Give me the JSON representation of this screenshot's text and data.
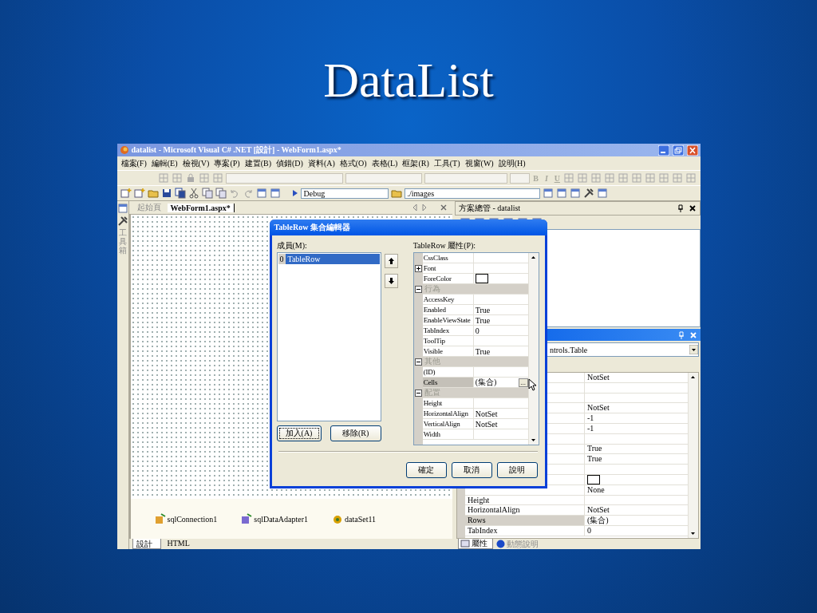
{
  "slide": {
    "title": "DataList"
  },
  "window": {
    "title": "datalist - Microsoft Visual C# .NET [設計] - WebForm1.aspx*"
  },
  "menu": [
    "檔案(F)",
    "編輯(E)",
    "檢視(V)",
    "專案(P)",
    "建置(B)",
    "偵錯(D)",
    "資料(A)",
    "格式(O)",
    "表格(L)",
    "框架(R)",
    "工具(T)",
    "視窗(W)",
    "說明(H)"
  ],
  "format_buttons": [
    {
      "label": "B",
      "disabled": true
    },
    {
      "label": "I",
      "disabled": true
    },
    {
      "label": "U",
      "disabled": true
    }
  ],
  "toolbar": {
    "configuration": "Debug",
    "path": "./images"
  },
  "side_strip": {
    "label": "工具箱"
  },
  "document_tabs": [
    {
      "label": "起始頁",
      "selected": false
    },
    {
      "label": "WebForm1.aspx*",
      "selected": true
    }
  ],
  "components": [
    "sqlConnection1",
    "sqlDataAdapter1",
    "dataSet11"
  ],
  "view_tabs": [
    {
      "label": "設計",
      "selected": true
    },
    {
      "label": "HTML",
      "selected": false
    }
  ],
  "solution_explorer": {
    "title": "方案總管 - datalist"
  },
  "properties": {
    "object": "ntrols.Table",
    "rows": [
      {
        "value": "NotSet",
        "kind": "text",
        "selected": false
      },
      {
        "kind": "blank",
        "selected": false
      },
      {
        "kind": "blank",
        "selected": false
      },
      {
        "value": "NotSet",
        "kind": "text",
        "selected": false
      },
      {
        "value": "-1",
        "kind": "text",
        "selected": false
      },
      {
        "value": "-1",
        "kind": "text",
        "selected": false
      },
      {
        "kind": "blank",
        "selected": false
      },
      {
        "value": "True",
        "kind": "text",
        "selected": false
      },
      {
        "value": "True",
        "kind": "text",
        "selected": false
      },
      {
        "kind": "blank",
        "selected": false
      },
      {
        "kind": "color",
        "selected": false
      },
      {
        "value": "None",
        "kind": "text",
        "selected": false
      },
      {
        "name": "Height",
        "kind": "text",
        "selected": false
      },
      {
        "name": "HorizontalAlign",
        "value": "NotSet",
        "kind": "text",
        "selected": false
      },
      {
        "name": "Rows",
        "value": "(集合)",
        "kind": "text",
        "selected": true
      },
      {
        "name": "TabIndex",
        "value": "0",
        "kind": "text",
        "selected": false
      }
    ],
    "tabs": [
      {
        "label": "屬性",
        "selected": true
      },
      {
        "label": "動態說明",
        "selected": false
      }
    ]
  },
  "dialog": {
    "title": "TableRow 集合編輯器",
    "members_label": "成員(M):",
    "members": [
      {
        "index": "0",
        "name": "TableRow",
        "selected": true
      }
    ],
    "add_button": "加入(A)",
    "remove_button": "移除(R)",
    "properties_label": "TableRow 屬性(P):",
    "properties": [
      {
        "kind": "property",
        "name": "CssClass",
        "selected": false
      },
      {
        "kind": "group",
        "name": "Font",
        "expanded": false,
        "selected": false
      },
      {
        "kind": "color",
        "name": "ForeColor",
        "selected": false
      },
      {
        "kind": "category",
        "name": "行為",
        "expanded": true
      },
      {
        "kind": "property",
        "name": "AccessKey",
        "selected": false
      },
      {
        "kind": "property",
        "name": "Enabled",
        "value": "True",
        "selected": false
      },
      {
        "kind": "property",
        "name": "EnableViewState",
        "value": "True",
        "selected": false
      },
      {
        "kind": "property",
        "name": "TabIndex",
        "value": "0",
        "selected": false
      },
      {
        "kind": "property",
        "name": "ToolTip",
        "selected": false
      },
      {
        "kind": "property",
        "name": "Visible",
        "value": "True",
        "selected": false
      },
      {
        "kind": "category",
        "name": "其他",
        "expanded": true
      },
      {
        "kind": "property",
        "name": "(ID)",
        "selected": false
      },
      {
        "kind": "property",
        "name": "Cells",
        "value": "(集合)",
        "button": "...",
        "selected": true
      },
      {
        "kind": "category",
        "name": "配置",
        "expanded": true
      },
      {
        "kind": "property",
        "name": "Height",
        "selected": false
      },
      {
        "kind": "property",
        "name": "HorizontalAlign",
        "value": "NotSet",
        "selected": false
      },
      {
        "kind": "property",
        "name": "VerticalAlign",
        "value": "NotSet",
        "selected": false
      },
      {
        "kind": "property",
        "name": "Width",
        "selected": false
      }
    ],
    "buttons": [
      "確定",
      "取消",
      "說明"
    ]
  }
}
